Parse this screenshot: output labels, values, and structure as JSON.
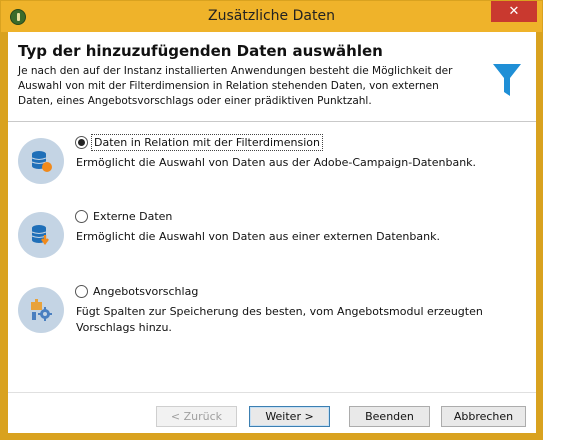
{
  "window": {
    "title": "Zusätzliche Daten",
    "close_glyph": "✕"
  },
  "header": {
    "title": "Typ der hinzuzufügenden Daten auswählen",
    "description": "Je nach den auf der Instanz installierten Anwendungen besteht die Möglichkeit der Auswahl von mit der Filterdimension in Relation stehenden Daten, von externen Daten, eines Angebotsvorschlags oder einer prädiktiven Punktzahl.",
    "icon": "funnel-icon"
  },
  "options": [
    {
      "label": "Daten in Relation mit der Filterdimension",
      "description": "Ermöglicht die Auswahl von Daten aus der Adobe-Campaign-Datenbank.",
      "selected": true,
      "icon": "database-icon"
    },
    {
      "label": "Externe Daten",
      "description": "Ermöglicht die Auswahl von Daten aus einer externen Datenbank.",
      "selected": false,
      "icon": "external-database-icon"
    },
    {
      "label": "Angebotsvorschlag",
      "description": "Fügt Spalten zur Speicherung des besten, vom Angebotsmodul erzeugten Vorschlags hinzu.",
      "selected": false,
      "icon": "offer-settings-icon"
    }
  ],
  "buttons": {
    "back": "< Zurück",
    "next": "Weiter >",
    "finish": "Beenden",
    "cancel": "Abbrechen"
  },
  "colors": {
    "titlebar": "#efb32a",
    "close": "#c9392f",
    "accent": "#1f8fd6",
    "icon_circle": "#c4d4e4"
  }
}
